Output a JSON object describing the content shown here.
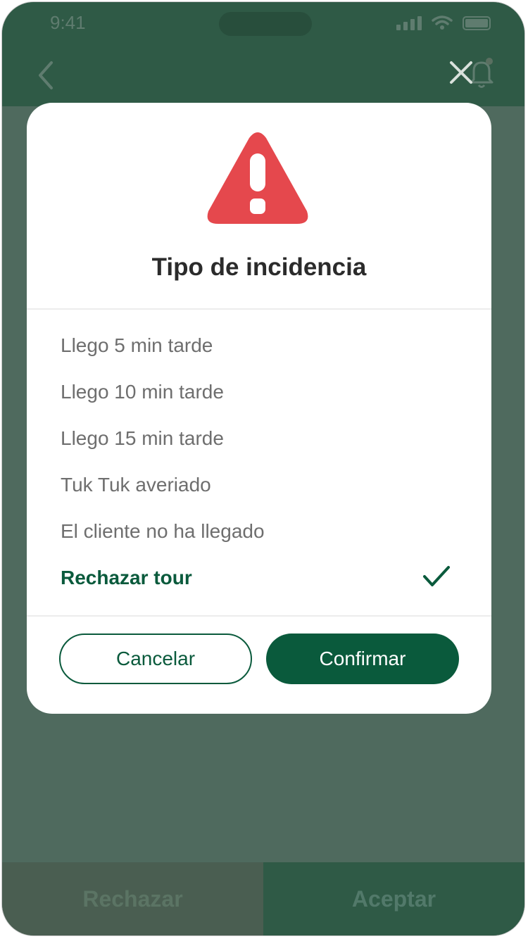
{
  "status_bar": {
    "time": "9:41"
  },
  "dialog": {
    "title": "Tipo de incidencia",
    "options": [
      {
        "label": "Llego 5 min tarde",
        "selected": false
      },
      {
        "label": "Llego 10 min tarde",
        "selected": false
      },
      {
        "label": "Llego 15 min tarde",
        "selected": false
      },
      {
        "label": "Tuk Tuk averiado",
        "selected": false
      },
      {
        "label": "El cliente no ha llegado",
        "selected": false
      },
      {
        "label": "Rechazar tour",
        "selected": true
      }
    ],
    "cancel_label": "Cancelar",
    "confirm_label": "Confirmar"
  },
  "bottom_bar": {
    "reject_label": "Rechazar",
    "accept_label": "Aceptar"
  },
  "colors": {
    "accent": "#0a5a3c",
    "warning": "#e5484d",
    "overlay": "#4f6a5e"
  },
  "icons": {
    "warning": "warning-triangle-icon",
    "check": "check-icon",
    "back": "chevron-left-icon",
    "close": "close-icon",
    "bell": "bell-icon"
  }
}
